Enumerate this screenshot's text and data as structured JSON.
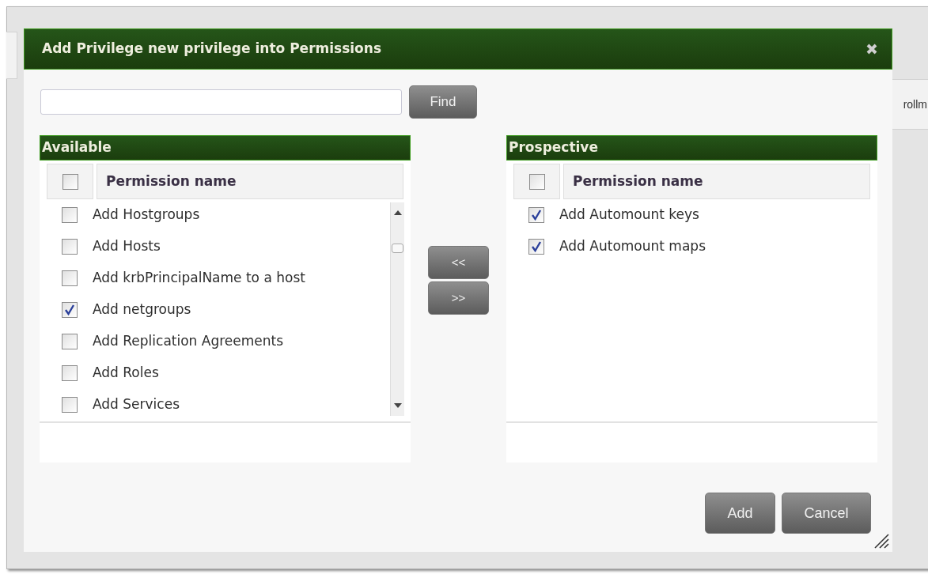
{
  "background_page": {
    "partial_text": "rollm"
  },
  "dialog": {
    "title": "Add Privilege new privilege into Permissions",
    "search": {
      "button": "Find"
    },
    "panels": [
      {
        "title": "Available",
        "column": "Permission name",
        "all_checked": false,
        "scrollbar": true,
        "items": [
          {
            "label": "Add Hostgroups",
            "checked": false
          },
          {
            "label": "Add Hosts",
            "checked": false
          },
          {
            "label": "Add krbPrincipalName to a host",
            "checked": false
          },
          {
            "label": "Add netgroups",
            "checked": true
          },
          {
            "label": "Add Replication Agreements",
            "checked": false
          },
          {
            "label": "Add Roles",
            "checked": false
          },
          {
            "label": "Add Services",
            "checked": false
          }
        ]
      },
      {
        "title": "Prospective",
        "column": "Permission name",
        "all_checked": false,
        "scrollbar": false,
        "items": [
          {
            "label": "Add Automount keys",
            "checked": true
          },
          {
            "label": "Add Automount maps",
            "checked": true
          }
        ]
      }
    ],
    "move_buttons": [
      "<<",
      ">>"
    ],
    "buttons": [
      "Add",
      "Cancel"
    ]
  }
}
